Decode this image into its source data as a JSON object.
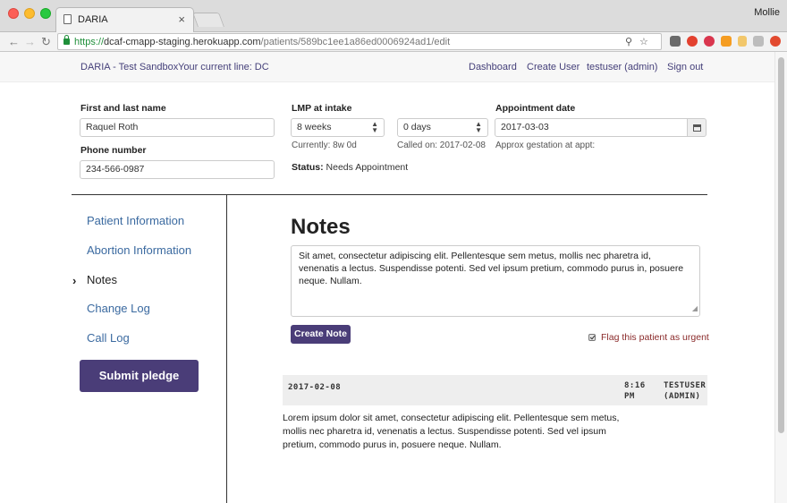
{
  "browser": {
    "tab_title": "DARIA",
    "tab_close": "×",
    "profile": "Mollie",
    "url_secure": "https://",
    "url_host": "dcaf-cmapp-staging.herokuapp.com",
    "url_path": "/patients/589bc1ee1a86ed0006924ad1/edit"
  },
  "header": {
    "brand": "DARIA - Test Sandbox",
    "line": "Your current line: DC",
    "nav": [
      "Dashboard",
      "Create User",
      "testuser (admin)",
      "Sign out"
    ]
  },
  "form": {
    "name_label": "First and last name",
    "name_value": "Raquel Roth",
    "phone_label": "Phone number",
    "phone_value": "234-566-0987",
    "lmp_label": "LMP at intake",
    "lmp_weeks": "8 weeks",
    "lmp_days": "0 days",
    "currently": "Currently: 8w 0d",
    "called_on": "Called on: 2017-02-08",
    "status_label": "Status:",
    "status_value": "Needs Appointment",
    "appt_label": "Appointment date",
    "appt_value": "2017-03-03",
    "approx_gestation": "Approx gestation at appt:"
  },
  "sidebar": {
    "items": [
      {
        "label": "Patient Information"
      },
      {
        "label": "Abortion Information"
      },
      {
        "label": "Notes"
      },
      {
        "label": "Change Log"
      },
      {
        "label": "Call Log"
      }
    ],
    "active": "Notes",
    "submit_label": "Submit pledge"
  },
  "notes": {
    "heading": "Notes",
    "draft": "Sit amet, consectetur adipiscing elit. Pellentesque sem metus, mollis nec pharetra id, venenatis a lectus. Suspendisse potenti. Sed vel ipsum pretium, commodo purus in, posuere neque. Nullam.",
    "create_label": "Create Note",
    "urgent_label": "Flag this patient as urgent",
    "urgent_checked": true,
    "entries": [
      {
        "date": "2017-02-08",
        "time": "8:16 PM",
        "user": "TESTUSER (ADMIN)",
        "body": "Lorem ipsum dolor sit amet, consectetur adipiscing elit. Pellentesque sem metus, mollis nec pharetra id, venenatis a lectus. Suspendisse potenti. Sed vel ipsum pretium, commodo purus in, posuere neque. Nullam."
      }
    ]
  },
  "colors": {
    "primary": "#4a3d78",
    "link": "#3b6aa0",
    "urgent": "#8a2a2a"
  }
}
